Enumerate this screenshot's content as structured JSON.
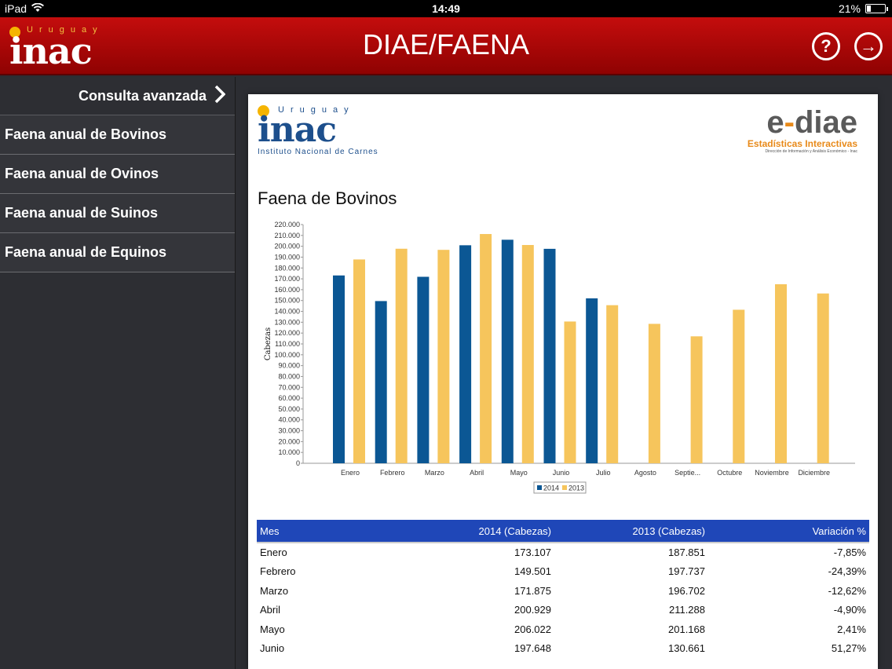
{
  "status": {
    "device": "iPad",
    "time": "14:49",
    "battery": "21%",
    "battery_level": 0.21
  },
  "header": {
    "title": "DIAE/FAENA",
    "logo_small": "Uruguay",
    "logo_word": "inac",
    "help_icon": "?",
    "next_icon": "→"
  },
  "sidebar": {
    "advanced": "Consulta avanzada",
    "items": [
      {
        "label": "Faena anual de Bovinos"
      },
      {
        "label": "Faena anual de Ovinos"
      },
      {
        "label": "Faena anual de Suinos"
      },
      {
        "label": "Faena anual de Equinos"
      }
    ]
  },
  "report": {
    "inac_small": "Uruguay",
    "inac_word": "inac",
    "inac_sub": "Instituto Nacional de Carnes",
    "ediae_e": "e",
    "ediae_dash": "-",
    "ediae_rest": "diae",
    "ediae_line1": "Estadísticas Interactivas",
    "ediae_line2": "Dirección de Información y Análisis Económico - Inac",
    "title": "Faena de Bovinos"
  },
  "colors": {
    "s2014": "#0b5794",
    "s2013": "#f6c55c",
    "header_red": "#b00808",
    "table_header": "#1f47b8"
  },
  "chart_data": {
    "type": "bar",
    "ylabel": "Cabezas",
    "ylim": [
      0,
      220000
    ],
    "ytick_step": 10000,
    "ytick_labels": [
      "0",
      "10.000",
      "20.000",
      "30.000",
      "40.000",
      "50.000",
      "60.000",
      "70.000",
      "80.000",
      "90.000",
      "100.000",
      "110.000",
      "120.000",
      "130.000",
      "140.000",
      "150.000",
      "160.000",
      "170.000",
      "180.000",
      "190.000",
      "200.000",
      "210.000",
      "220.000"
    ],
    "categories": [
      "Enero",
      "Febrero",
      "Marzo",
      "Abril",
      "Mayo",
      "Junio",
      "Julio",
      "Agosto",
      "Septie...",
      "Octubre",
      "Noviembre",
      "Diciembre"
    ],
    "series": [
      {
        "name": "2014",
        "values": [
          173107,
          149501,
          171875,
          200929,
          206022,
          197648,
          152000,
          null,
          null,
          null,
          null,
          null
        ]
      },
      {
        "name": "2013",
        "values": [
          187851,
          197737,
          196702,
          211288,
          201168,
          130661,
          145700,
          128500,
          117000,
          141500,
          165000,
          156500
        ]
      }
    ],
    "legend": "bottom-center"
  },
  "table": {
    "headers": [
      "Mes",
      "2014 (Cabezas)",
      "2013 (Cabezas)",
      "Variación %"
    ],
    "rows": [
      [
        "Enero",
        "173.107",
        "187.851",
        "-7,85%"
      ],
      [
        "Febrero",
        "149.501",
        "197.737",
        "-24,39%"
      ],
      [
        "Marzo",
        "171.875",
        "196.702",
        "-12,62%"
      ],
      [
        "Abril",
        "200.929",
        "211.288",
        "-4,90%"
      ],
      [
        "Mayo",
        "206.022",
        "201.168",
        "2,41%"
      ],
      [
        "Junio",
        "197.648",
        "130.661",
        "51,27%"
      ]
    ]
  }
}
